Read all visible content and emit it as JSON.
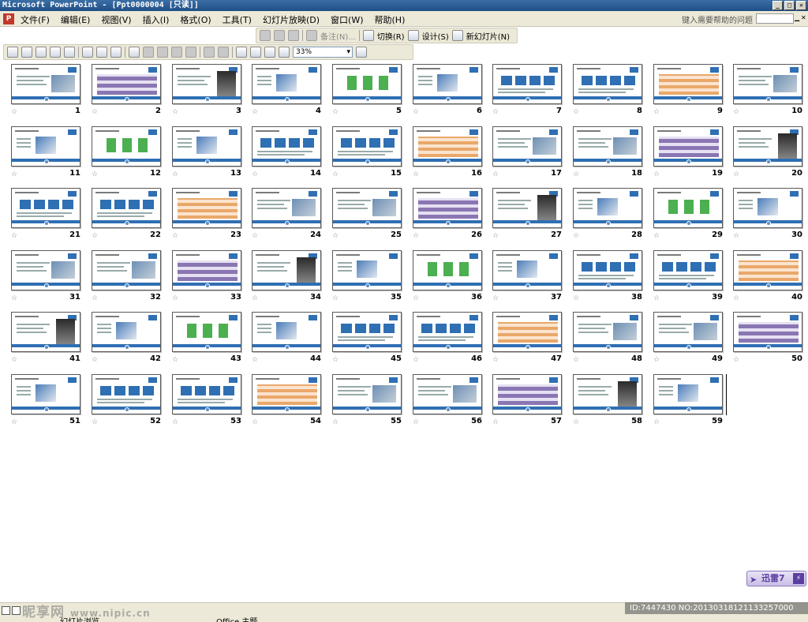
{
  "window": {
    "title": "Microsoft PowerPoint - [Ppt0000004 [只读]]",
    "buttons": [
      "_",
      "□",
      "✕"
    ]
  },
  "menubar": {
    "app_icon": "P",
    "items": [
      "文件(F)",
      "编辑(E)",
      "视图(V)",
      "插入(I)",
      "格式(O)",
      "工具(T)",
      "幻灯片放映(D)",
      "窗口(W)",
      "帮助(H)"
    ],
    "help_prompt": "键入需要帮助的问题"
  },
  "toolbar_view": {
    "notes": "备注(N)...",
    "transition": "切换(R)",
    "design": "设计(S)",
    "new_slide": "新幻灯片(N)"
  },
  "toolbar_standard": {
    "zoom": "33%"
  },
  "slides": [
    {
      "num": "1"
    },
    {
      "num": "2"
    },
    {
      "num": "3"
    },
    {
      "num": "4"
    },
    {
      "num": "5"
    },
    {
      "num": "6"
    },
    {
      "num": "7"
    },
    {
      "num": "8"
    },
    {
      "num": "9"
    },
    {
      "num": "10"
    },
    {
      "num": "11"
    },
    {
      "num": "12"
    },
    {
      "num": "13"
    },
    {
      "num": "14"
    },
    {
      "num": "15"
    },
    {
      "num": "16"
    },
    {
      "num": "17"
    },
    {
      "num": "18"
    },
    {
      "num": "19"
    },
    {
      "num": "20"
    },
    {
      "num": "21"
    },
    {
      "num": "22"
    },
    {
      "num": "23"
    },
    {
      "num": "24"
    },
    {
      "num": "25"
    },
    {
      "num": "26"
    },
    {
      "num": "27"
    },
    {
      "num": "28"
    },
    {
      "num": "29"
    },
    {
      "num": "30"
    },
    {
      "num": "31"
    },
    {
      "num": "32"
    },
    {
      "num": "33"
    },
    {
      "num": "34"
    },
    {
      "num": "35"
    },
    {
      "num": "36"
    },
    {
      "num": "37"
    },
    {
      "num": "38"
    },
    {
      "num": "39"
    },
    {
      "num": "40"
    },
    {
      "num": "41"
    },
    {
      "num": "42"
    },
    {
      "num": "43"
    },
    {
      "num": "44"
    },
    {
      "num": "45"
    },
    {
      "num": "46"
    },
    {
      "num": "47"
    },
    {
      "num": "48"
    },
    {
      "num": "49"
    },
    {
      "num": "50"
    },
    {
      "num": "51"
    },
    {
      "num": "52"
    },
    {
      "num": "53"
    },
    {
      "num": "54"
    },
    {
      "num": "55"
    },
    {
      "num": "56"
    },
    {
      "num": "57"
    },
    {
      "num": "58"
    },
    {
      "num": "59"
    }
  ],
  "statusbar": {
    "view": "幻灯片浏览",
    "theme": "Office 主题"
  },
  "badge": {
    "label": "迅雷7"
  },
  "watermark": {
    "brand": "昵享网",
    "url": "www.nipic.cn",
    "id_text": "ID:7447430 NO:20130318121133257000"
  },
  "colors": {
    "accent": "#2f6fb3",
    "titlebar": "#1f4f86",
    "chrome": "#ece9d8"
  }
}
